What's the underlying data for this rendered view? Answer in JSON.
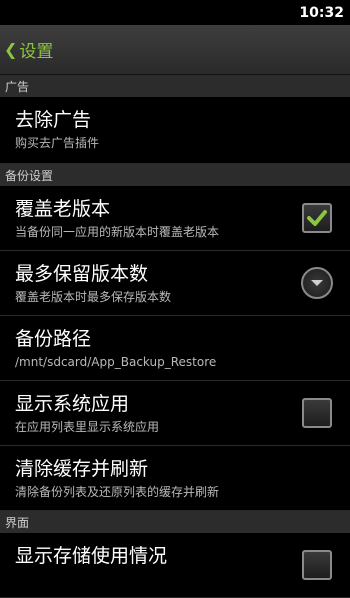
{
  "status_bar": {
    "time": "10:32"
  },
  "action_bar": {
    "title": "设置"
  },
  "sections": [
    {
      "header": "广告"
    },
    {
      "header": "备份设置"
    },
    {
      "header": "界面"
    }
  ],
  "prefs": {
    "remove_ads": {
      "title": "去除广告",
      "summary": "购买去广告插件"
    },
    "overwrite_old": {
      "title": "覆盖老版本",
      "summary": "当备份同一应用的新版本时覆盖老版本",
      "checked": true
    },
    "max_versions": {
      "title": "最多保留版本数",
      "summary": "覆盖老版本时最多保存版本数"
    },
    "backup_path": {
      "title": "备份路径",
      "summary": "/mnt/sdcard/App_Backup_Restore"
    },
    "show_system_apps": {
      "title": "显示系统应用",
      "summary": "在应用列表里显示系统应用",
      "checked": false
    },
    "clear_cache": {
      "title": "清除缓存并刷新",
      "summary": "清除备份列表及还原列表的缓存并刷新"
    },
    "show_storage": {
      "title": "显示存储使用情况",
      "checked": false
    }
  },
  "colors": {
    "accent": "#8cc63f",
    "check": "#8cc63f"
  }
}
